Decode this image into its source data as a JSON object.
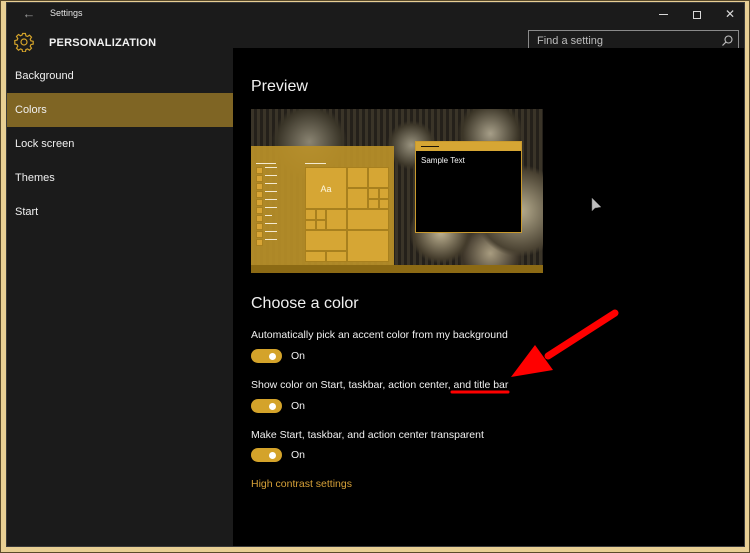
{
  "window": {
    "title": "Settings",
    "controls": {
      "minimize": "minimize",
      "maximize": "maximize",
      "close": "close"
    }
  },
  "header": {
    "title": "PERSONALIZATION",
    "icon": "gear-icon",
    "search": {
      "placeholder": "Find a setting",
      "value": ""
    }
  },
  "sidebar": {
    "items": [
      {
        "label": "Background",
        "active": false
      },
      {
        "label": "Colors",
        "active": true
      },
      {
        "label": "Lock screen",
        "active": false
      },
      {
        "label": "Themes",
        "active": false
      },
      {
        "label": "Start",
        "active": false
      }
    ]
  },
  "content": {
    "preview_heading": "Preview",
    "preview": {
      "tile_text": "Aa",
      "sample_text": "Sample Text"
    },
    "choose_heading": "Choose a color",
    "settings": [
      {
        "label": "Automatically pick an accent color from my background",
        "state": "On",
        "enabled": true
      },
      {
        "label": "Show color on Start, taskbar, action center, and title bar",
        "state": "On",
        "enabled": true
      },
      {
        "label": "Make Start, taskbar, and action center transparent",
        "state": "On",
        "enabled": true
      }
    ],
    "link": "High contrast settings"
  },
  "colors": {
    "accent": "#d4a32a",
    "sidebar_active": "#7f6524",
    "link": "#d6a038",
    "annotation": "#ff0000"
  }
}
